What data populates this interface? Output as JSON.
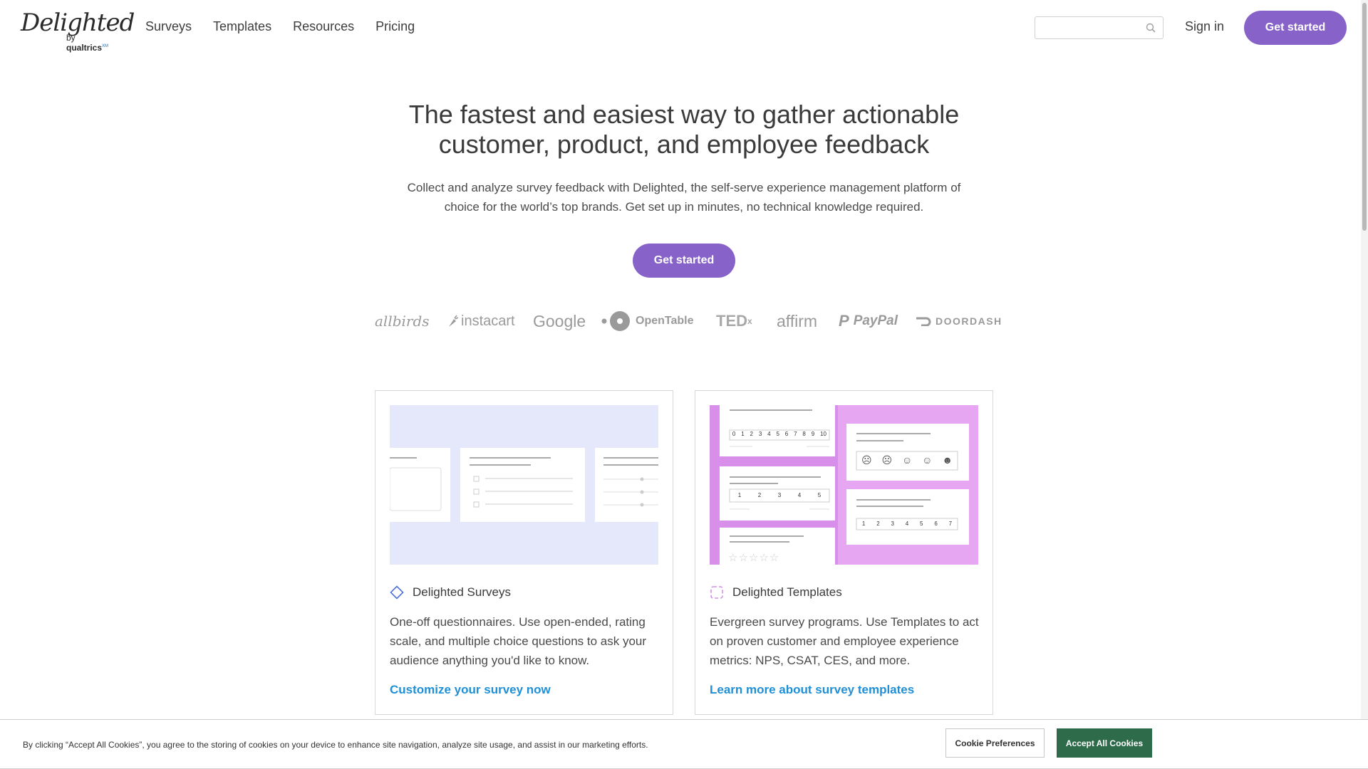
{
  "brand": {
    "logo_script": "Delighted",
    "by": "by",
    "parent": "qualtrics",
    "mark": "XM"
  },
  "nav": {
    "items": [
      "Surveys",
      "Templates",
      "Resources",
      "Pricing"
    ]
  },
  "search": {
    "placeholder": "",
    "value": ""
  },
  "header": {
    "sign_in": "Sign in",
    "cta": "Get started"
  },
  "hero": {
    "title_line1": "The fastest and easiest way to gather actionable",
    "title_line2": "customer, product, and employee feedback",
    "subtitle_line1": "Collect and analyze survey feedback with Delighted, the self-serve experience management platform of",
    "subtitle_line2": "choice for the world’s top brands. Get set up in minutes, no technical knowledge required.",
    "cta": "Get started"
  },
  "customer_logos": [
    "allbirds",
    "instacart",
    "Google",
    "OpenTable",
    "TED",
    "affirm",
    "PayPal",
    "DOORDASH"
  ],
  "cards": [
    {
      "heading": "Delighted Surveys",
      "icon": "diamond-icon",
      "description": "One-off questionnaires. Use open-ended, rating scale, and multiple choice questions to ask your audience anything you'd like to know.",
      "link": "Customize your survey now",
      "accent": "#4a6fd8",
      "illus_bg": "#e5e8fb"
    },
    {
      "heading": "Delighted Templates",
      "icon": "dashed-square-icon",
      "description": "Evergreen survey programs. Use Templates to act on proven customer and employee experience metrics: NPS, CSAT, CES, and more.",
      "link": "Learn more about survey templates",
      "accent": "#d58ee8",
      "illus_bg": "#e6a6f2"
    }
  ],
  "templates_illustration": {
    "nps_scale": [
      "0",
      "1",
      "2",
      "3",
      "4",
      "5",
      "6",
      "7",
      "8",
      "9",
      "10"
    ],
    "five_scale": [
      "1",
      "2",
      "3",
      "4",
      "5"
    ],
    "seven_scale": [
      "1",
      "2",
      "3",
      "4",
      "5",
      "6",
      "7"
    ]
  },
  "cookie_banner": {
    "text": "By clicking “Accept All Cookies”, you agree to the storing of cookies on your device to enhance site navigation, analyze site usage, and assist in our marketing efforts.",
    "preferences": "Cookie Preferences",
    "accept": "Accept All Cookies"
  },
  "colors": {
    "primary": "#8763c9",
    "link": "#1f8fd6",
    "accept": "#2e6b4b"
  }
}
